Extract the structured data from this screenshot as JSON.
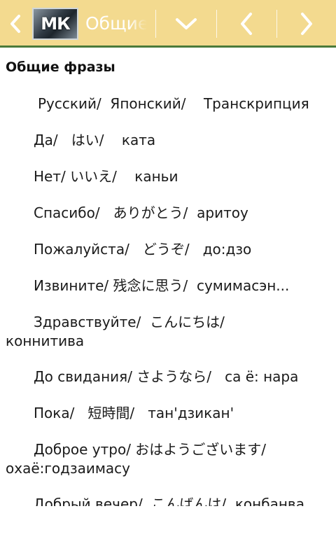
{
  "appbar": {
    "back_icon": "chevron-left-icon",
    "logo_text": "МК",
    "title": "Общие фразы",
    "menu_icon": "chevron-down-icon",
    "prev_icon": "chevron-left-icon",
    "next_icon": "chevron-right-icon",
    "bg_color": "#f3da8f",
    "underline_color": "#4a7a3a"
  },
  "content": {
    "heading": "Общие фразы",
    "header_row": "Русский/  Японский/    Транскрипция",
    "phrases": [
      {
        "text": "Да/   はい/    ката"
      },
      {
        "text": "Нет/ いいえ/    каньи"
      },
      {
        "text": "Спасибо/   ありがとう/  аритоу"
      },
      {
        "text": "Пожалуйста/   どうぞ/   до:дзо"
      },
      {
        "text": "Извините/ 残念に思う/  сумимасэн..."
      },
      {
        "text": "Здравствуйте/  こんにちは/",
        "wrap": "коннитива"
      },
      {
        "text": "До свидания/ さようなら/   са ё: нара"
      },
      {
        "text": "Пока/   短時間/   тан'дзикан'"
      },
      {
        "text": "Доброе утро/ おはようございます/",
        "wrap": "охаё:годзаимасу"
      },
      {
        "text": "Добрый вечер/  こんばんは/  конбанва"
      }
    ]
  }
}
